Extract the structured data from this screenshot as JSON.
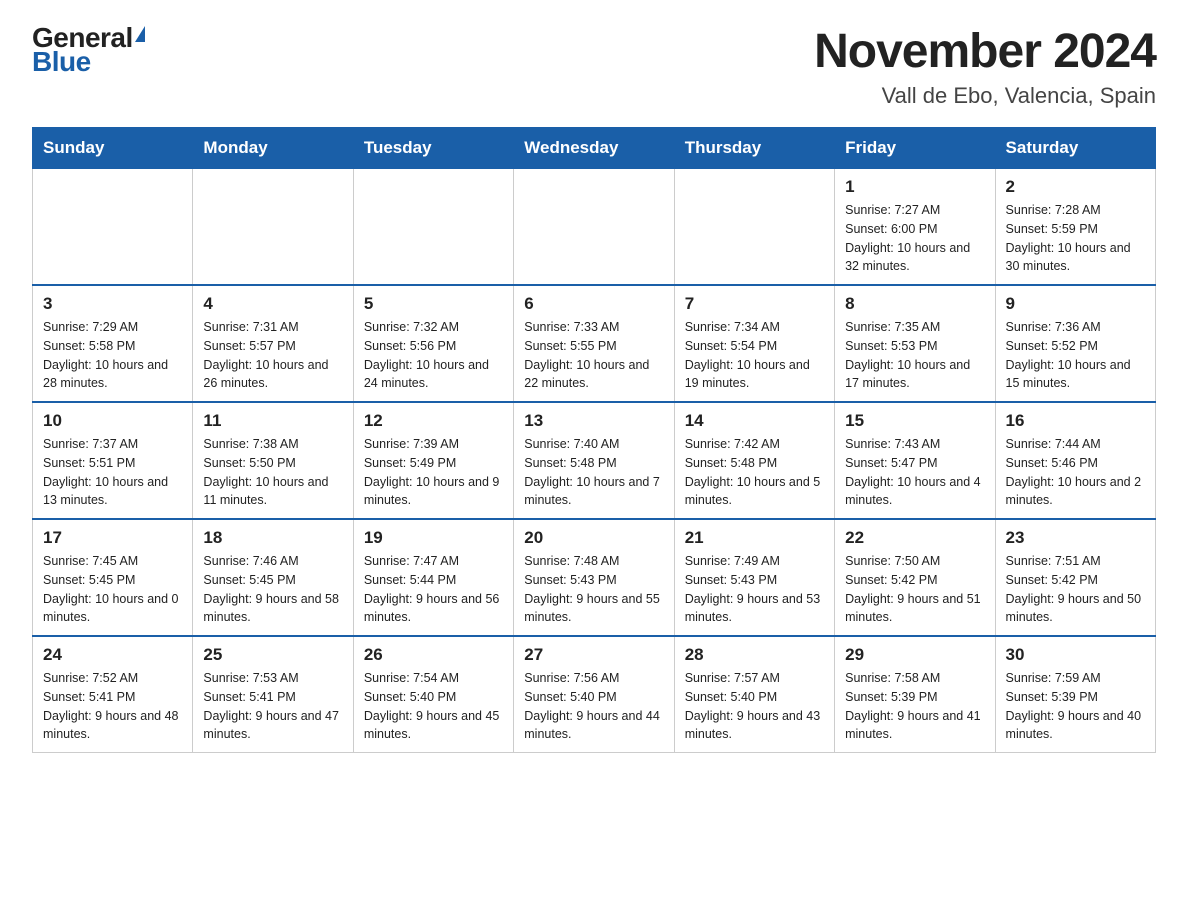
{
  "logo": {
    "general": "General",
    "blue": "Blue"
  },
  "title": "November 2024",
  "location": "Vall de Ebo, Valencia, Spain",
  "weekdays": [
    "Sunday",
    "Monday",
    "Tuesday",
    "Wednesday",
    "Thursday",
    "Friday",
    "Saturday"
  ],
  "weeks": [
    [
      {
        "day": "",
        "info": ""
      },
      {
        "day": "",
        "info": ""
      },
      {
        "day": "",
        "info": ""
      },
      {
        "day": "",
        "info": ""
      },
      {
        "day": "",
        "info": ""
      },
      {
        "day": "1",
        "info": "Sunrise: 7:27 AM\nSunset: 6:00 PM\nDaylight: 10 hours and 32 minutes."
      },
      {
        "day": "2",
        "info": "Sunrise: 7:28 AM\nSunset: 5:59 PM\nDaylight: 10 hours and 30 minutes."
      }
    ],
    [
      {
        "day": "3",
        "info": "Sunrise: 7:29 AM\nSunset: 5:58 PM\nDaylight: 10 hours and 28 minutes."
      },
      {
        "day": "4",
        "info": "Sunrise: 7:31 AM\nSunset: 5:57 PM\nDaylight: 10 hours and 26 minutes."
      },
      {
        "day": "5",
        "info": "Sunrise: 7:32 AM\nSunset: 5:56 PM\nDaylight: 10 hours and 24 minutes."
      },
      {
        "day": "6",
        "info": "Sunrise: 7:33 AM\nSunset: 5:55 PM\nDaylight: 10 hours and 22 minutes."
      },
      {
        "day": "7",
        "info": "Sunrise: 7:34 AM\nSunset: 5:54 PM\nDaylight: 10 hours and 19 minutes."
      },
      {
        "day": "8",
        "info": "Sunrise: 7:35 AM\nSunset: 5:53 PM\nDaylight: 10 hours and 17 minutes."
      },
      {
        "day": "9",
        "info": "Sunrise: 7:36 AM\nSunset: 5:52 PM\nDaylight: 10 hours and 15 minutes."
      }
    ],
    [
      {
        "day": "10",
        "info": "Sunrise: 7:37 AM\nSunset: 5:51 PM\nDaylight: 10 hours and 13 minutes."
      },
      {
        "day": "11",
        "info": "Sunrise: 7:38 AM\nSunset: 5:50 PM\nDaylight: 10 hours and 11 minutes."
      },
      {
        "day": "12",
        "info": "Sunrise: 7:39 AM\nSunset: 5:49 PM\nDaylight: 10 hours and 9 minutes."
      },
      {
        "day": "13",
        "info": "Sunrise: 7:40 AM\nSunset: 5:48 PM\nDaylight: 10 hours and 7 minutes."
      },
      {
        "day": "14",
        "info": "Sunrise: 7:42 AM\nSunset: 5:48 PM\nDaylight: 10 hours and 5 minutes."
      },
      {
        "day": "15",
        "info": "Sunrise: 7:43 AM\nSunset: 5:47 PM\nDaylight: 10 hours and 4 minutes."
      },
      {
        "day": "16",
        "info": "Sunrise: 7:44 AM\nSunset: 5:46 PM\nDaylight: 10 hours and 2 minutes."
      }
    ],
    [
      {
        "day": "17",
        "info": "Sunrise: 7:45 AM\nSunset: 5:45 PM\nDaylight: 10 hours and 0 minutes."
      },
      {
        "day": "18",
        "info": "Sunrise: 7:46 AM\nSunset: 5:45 PM\nDaylight: 9 hours and 58 minutes."
      },
      {
        "day": "19",
        "info": "Sunrise: 7:47 AM\nSunset: 5:44 PM\nDaylight: 9 hours and 56 minutes."
      },
      {
        "day": "20",
        "info": "Sunrise: 7:48 AM\nSunset: 5:43 PM\nDaylight: 9 hours and 55 minutes."
      },
      {
        "day": "21",
        "info": "Sunrise: 7:49 AM\nSunset: 5:43 PM\nDaylight: 9 hours and 53 minutes."
      },
      {
        "day": "22",
        "info": "Sunrise: 7:50 AM\nSunset: 5:42 PM\nDaylight: 9 hours and 51 minutes."
      },
      {
        "day": "23",
        "info": "Sunrise: 7:51 AM\nSunset: 5:42 PM\nDaylight: 9 hours and 50 minutes."
      }
    ],
    [
      {
        "day": "24",
        "info": "Sunrise: 7:52 AM\nSunset: 5:41 PM\nDaylight: 9 hours and 48 minutes."
      },
      {
        "day": "25",
        "info": "Sunrise: 7:53 AM\nSunset: 5:41 PM\nDaylight: 9 hours and 47 minutes."
      },
      {
        "day": "26",
        "info": "Sunrise: 7:54 AM\nSunset: 5:40 PM\nDaylight: 9 hours and 45 minutes."
      },
      {
        "day": "27",
        "info": "Sunrise: 7:56 AM\nSunset: 5:40 PM\nDaylight: 9 hours and 44 minutes."
      },
      {
        "day": "28",
        "info": "Sunrise: 7:57 AM\nSunset: 5:40 PM\nDaylight: 9 hours and 43 minutes."
      },
      {
        "day": "29",
        "info": "Sunrise: 7:58 AM\nSunset: 5:39 PM\nDaylight: 9 hours and 41 minutes."
      },
      {
        "day": "30",
        "info": "Sunrise: 7:59 AM\nSunset: 5:39 PM\nDaylight: 9 hours and 40 minutes."
      }
    ]
  ]
}
